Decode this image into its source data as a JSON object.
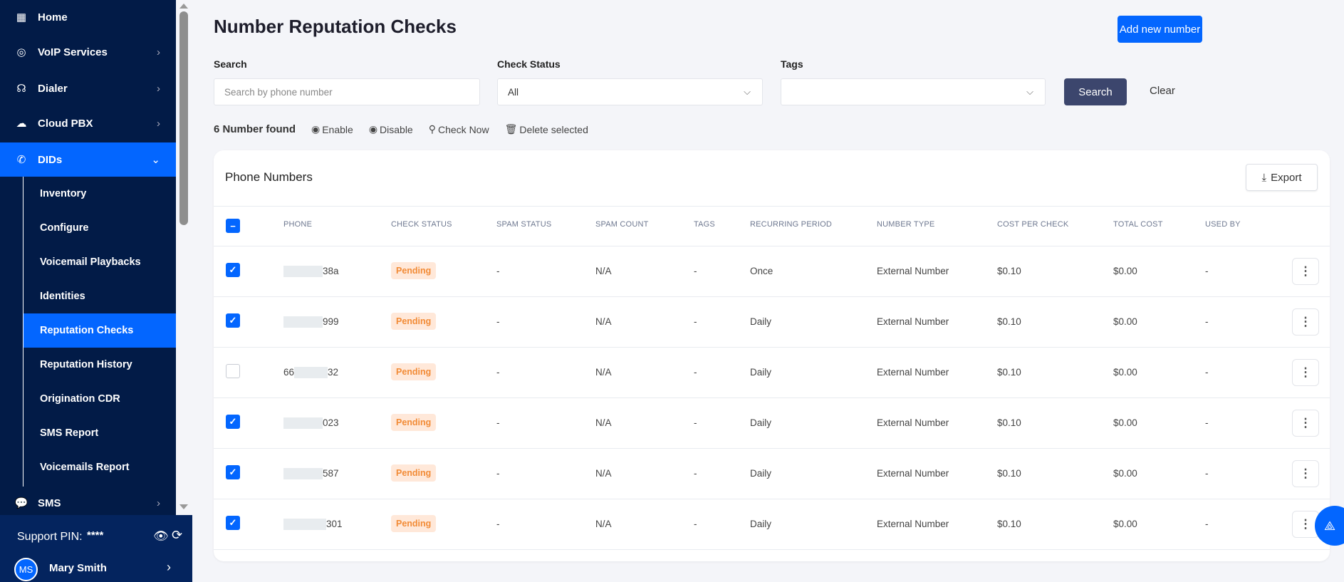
{
  "sidebar": {
    "items": [
      {
        "label": "Home",
        "icon": "grid-icon"
      },
      {
        "label": "VoIP Services",
        "icon": "voip-icon"
      },
      {
        "label": "Dialer",
        "icon": "headset-icon"
      },
      {
        "label": "Cloud PBX",
        "icon": "cloud-icon"
      },
      {
        "label": "DIDs",
        "icon": "phone-incoming-icon"
      }
    ],
    "sub_items": [
      "Inventory",
      "Configure",
      "Voicemail Playbacks",
      "Identities",
      "Reputation Checks",
      "Reputation History",
      "Origination CDR",
      "SMS Report",
      "Voicemails Report"
    ],
    "sms": {
      "label": "SMS",
      "icon": "chat-icon"
    },
    "support_pin_label": "Support PIN:",
    "support_pin_value": "****",
    "user": {
      "initials": "MS",
      "name": "Mary Smith"
    }
  },
  "header": {
    "title": "Number Reputation Checks",
    "add_button": "Add new number"
  },
  "filters": {
    "search_label": "Search",
    "search_placeholder": "Search by phone number",
    "status_label": "Check Status",
    "status_value": "All",
    "tags_label": "Tags",
    "tags_value": "",
    "search_button": "Search",
    "clear_button": "Clear"
  },
  "toolbar": {
    "count": "6 Number found",
    "enable": "Enable",
    "disable": "Disable",
    "check_now": "Check Now",
    "delete": "Delete selected"
  },
  "table": {
    "title": "Phone Numbers",
    "export": "Export",
    "columns": [
      "PHONE",
      "CHECK STATUS",
      "SPAM STATUS",
      "SPAM COUNT",
      "TAGS",
      "RECURRING PERIOD",
      "NUMBER TYPE",
      "COST PER CHECK",
      "TOTAL COST",
      "USED BY"
    ],
    "rows": [
      {
        "checked": true,
        "phone_prefix": "",
        "phone_suffix": "38a",
        "check_status": "Pending",
        "spam_status": "-",
        "spam_count": "N/A",
        "tags": "-",
        "recurring": "Once",
        "number_type": "External Number",
        "cost_per_check": "$0.10",
        "total_cost": "$0.00",
        "used_by": "-"
      },
      {
        "checked": true,
        "phone_prefix": "",
        "phone_suffix": "999",
        "check_status": "Pending",
        "spam_status": "-",
        "spam_count": "N/A",
        "tags": "-",
        "recurring": "Daily",
        "number_type": "External Number",
        "cost_per_check": "$0.10",
        "total_cost": "$0.00",
        "used_by": "-"
      },
      {
        "checked": false,
        "phone_prefix": "66",
        "phone_suffix": "32",
        "check_status": "Pending",
        "spam_status": "-",
        "spam_count": "N/A",
        "tags": "-",
        "recurring": "Daily",
        "number_type": "External Number",
        "cost_per_check": "$0.10",
        "total_cost": "$0.00",
        "used_by": "-"
      },
      {
        "checked": true,
        "phone_prefix": "",
        "phone_suffix": "023",
        "check_status": "Pending",
        "spam_status": "-",
        "spam_count": "N/A",
        "tags": "-",
        "recurring": "Daily",
        "number_type": "External Number",
        "cost_per_check": "$0.10",
        "total_cost": "$0.00",
        "used_by": "-"
      },
      {
        "checked": true,
        "phone_prefix": "",
        "phone_suffix": "587",
        "check_status": "Pending",
        "spam_status": "-",
        "spam_count": "N/A",
        "tags": "-",
        "recurring": "Daily",
        "number_type": "External Number",
        "cost_per_check": "$0.10",
        "total_cost": "$0.00",
        "used_by": "-"
      },
      {
        "checked": true,
        "phone_prefix": "",
        "phone_suffix": "301",
        "check_status": "Pending",
        "spam_status": "-",
        "spam_count": "N/A",
        "tags": "-",
        "recurring": "Daily",
        "number_type": "External Number",
        "cost_per_check": "$0.10",
        "total_cost": "$0.00",
        "used_by": "-"
      }
    ]
  },
  "colors": {
    "sidebar": "#021b47",
    "accent": "#0366ff",
    "search_button": "#3c466d",
    "badge_bg": "#ffe8d9",
    "badge_text": "#f28b36"
  }
}
